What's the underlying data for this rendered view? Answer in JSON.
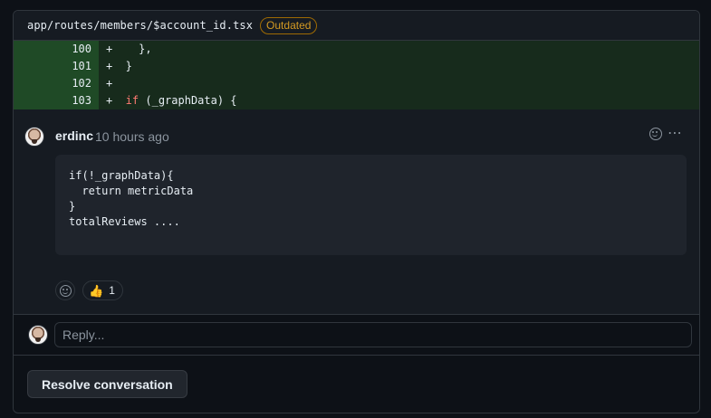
{
  "file": {
    "path": "app/routes/members/$account_id.tsx",
    "badge": "Outdated"
  },
  "diff": {
    "lines": [
      {
        "num": "100",
        "sign": "+",
        "code": "    },",
        "keyword": ""
      },
      {
        "num": "101",
        "sign": "+",
        "code": "  }",
        "keyword": ""
      },
      {
        "num": "102",
        "sign": "+",
        "code": "",
        "keyword": ""
      },
      {
        "num": "103",
        "sign": "+",
        "code": " (_graphData) {",
        "keyword": "  if"
      }
    ]
  },
  "comment": {
    "author": "erdinc",
    "timestamp": "10 hours ago",
    "code": "if(!_graphData){\n  return metricData\n}\ntotalReviews ....",
    "reaction": {
      "emoji": "👍",
      "count": "1"
    }
  },
  "reply": {
    "placeholder": "Reply..."
  },
  "actions": {
    "resolve_label": "Resolve conversation"
  },
  "icons": {
    "more": "⋯"
  },
  "colors": {
    "diff_added_num_bg": "#1f4a26",
    "diff_added_code_bg": "#172b1c",
    "outdated": "#d29922",
    "keyword": "#ff7b72"
  }
}
